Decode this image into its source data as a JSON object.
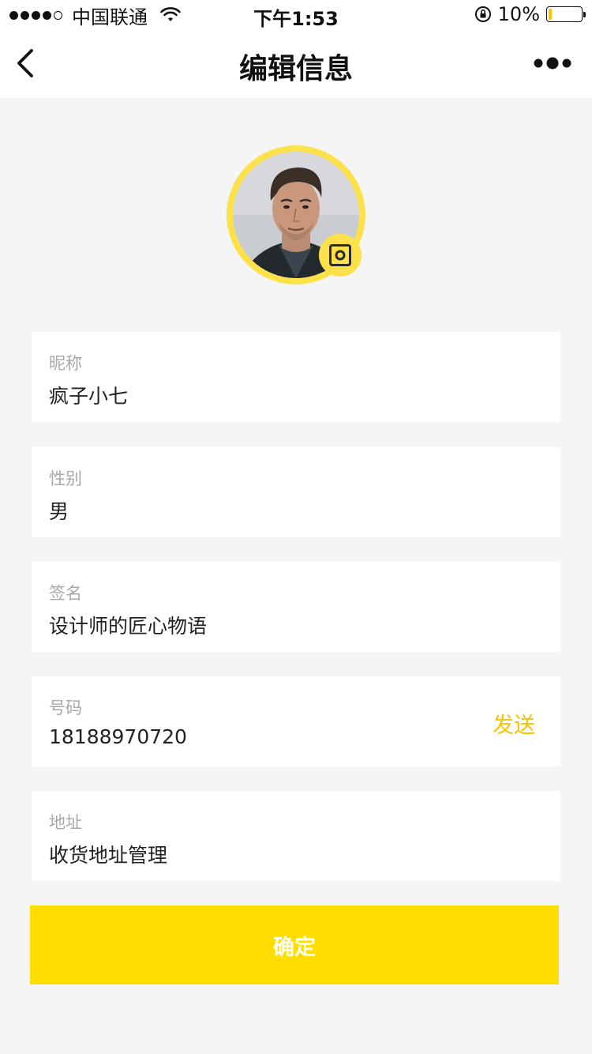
{
  "status_bar": {
    "carrier": "中国联通",
    "time": "下午1:53",
    "battery": "10%",
    "battery_level": 0.1,
    "signal_bars": 4
  },
  "header": {
    "title": "编辑信息",
    "back_icon": "chevron-left-icon",
    "more_icon": "more-dots-icon"
  },
  "profile": {
    "avatar_icon": "user-photo",
    "camera_icon": "camera-icon"
  },
  "fields": [
    {
      "label": "昵称",
      "value": "疯子小七"
    },
    {
      "label": "性别",
      "value": "男"
    },
    {
      "label": "签名",
      "value": "设计师的匠心物语"
    },
    {
      "label": "号码",
      "value": "18188970720",
      "action": "发送"
    },
    {
      "label": "地址",
      "value": "收货地址管理"
    }
  ],
  "confirm_label": "确定",
  "colors": {
    "accent": "#ffdd00",
    "action_text": "#f6c500",
    "background": "#f5f5f5"
  }
}
